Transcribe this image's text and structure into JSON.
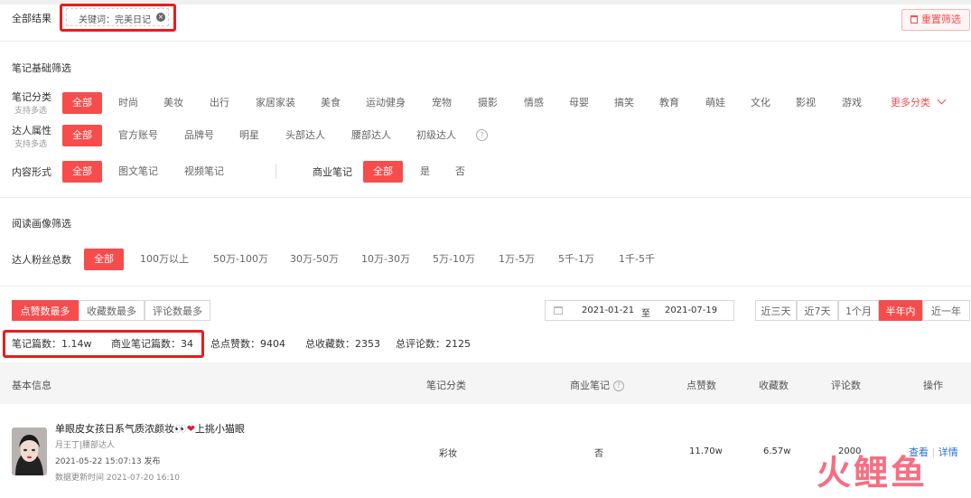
{
  "top": {
    "all_results_label": "全部结果",
    "keyword_tag": "关键词：完美日记",
    "reset_label": "重置筛选"
  },
  "basic_filter": {
    "title": "笔记基础筛选",
    "category": {
      "label": "笔记分类",
      "sub": "支持多选",
      "active": "全部",
      "options": [
        "时尚",
        "美妆",
        "出行",
        "家居家装",
        "美食",
        "运动健身",
        "宠物",
        "摄影",
        "情感",
        "母婴",
        "搞笑",
        "教育",
        "萌娃",
        "文化",
        "影视",
        "游戏"
      ],
      "more": "更多分类"
    },
    "influencer": {
      "label": "达人属性",
      "sub": "支持多选",
      "active": "全部",
      "options": [
        "官方账号",
        "品牌号",
        "明星",
        "头部达人",
        "腰部达人",
        "初级达人"
      ]
    },
    "content_form": {
      "label": "内容形式",
      "active": "全部",
      "options": [
        "图文笔记",
        "视频笔记"
      ]
    },
    "commercial": {
      "label": "商业笔记",
      "active": "全部",
      "options": [
        "是",
        "否"
      ]
    }
  },
  "reading_filter": {
    "title": "阅读画像筛选",
    "fans": {
      "label": "达人粉丝总数",
      "active": "全部",
      "options": [
        "100万以上",
        "50万-100万",
        "30万-50万",
        "10万-30万",
        "5万-10万",
        "1万-5万",
        "5千-1万",
        "1千-5千"
      ]
    }
  },
  "sort": {
    "tabs": [
      "点赞数最多",
      "收藏数最多",
      "评论数最多"
    ],
    "active_index": 0
  },
  "date": {
    "start": "2021-01-21",
    "sep": "至",
    "end": "2021-07-19"
  },
  "range": {
    "tabs": [
      "近三天",
      "近7天",
      "1个月",
      "半年内",
      "近一年"
    ],
    "active_index": 3
  },
  "stats": {
    "notes": "笔记篇数：1.14w",
    "commercial_notes": "商业笔记篇数：34",
    "likes": "总点赞数：9404",
    "favorites": "总收藏数：2353",
    "comments": "总评论数：2125"
  },
  "table": {
    "headers": {
      "basic": "基本信息",
      "category": "笔记分类",
      "commercial": "商业笔记",
      "likes": "点赞数",
      "favorites": "收藏数",
      "comments": "评论数",
      "action": "操作"
    },
    "rows": [
      {
        "title": "单眼皮女孩日系气质浓颜妆",
        "author": "月王丁|腰部达人",
        "published": "2021-05-22 15:07:13 发布",
        "updated": "数据更新时间 2021-07-20 16:10",
        "category": "彩妆",
        "commercial": "否",
        "likes": "11.70w",
        "favorites": "6.57w",
        "comments": "2000",
        "view": "查看",
        "detail": "详情"
      }
    ],
    "title_suffix": "上挑小猫眼"
  },
  "watermark": "火鲤鱼",
  "colors": {
    "accent": "#f74c4c",
    "outline": "#e81c1c"
  }
}
